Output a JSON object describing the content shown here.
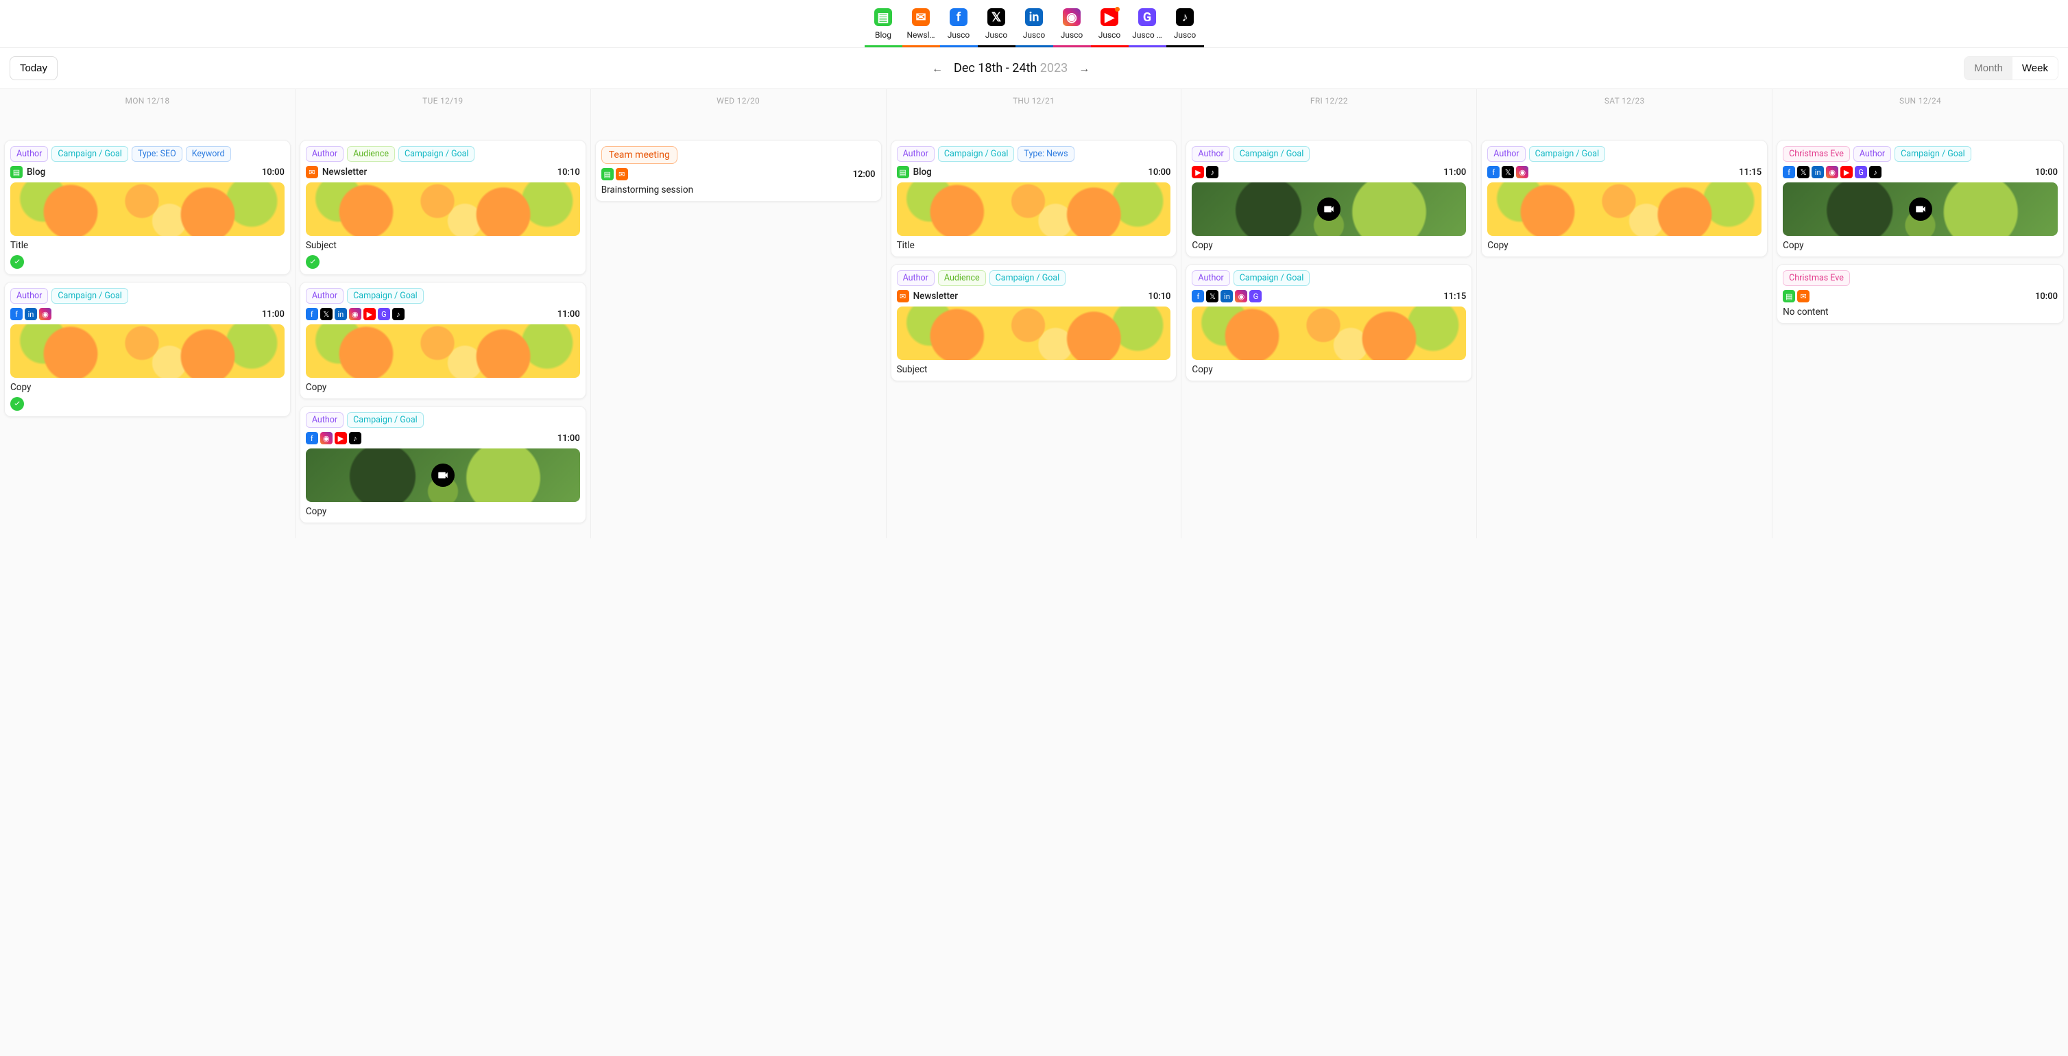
{
  "tabs": [
    {
      "label": "Blog",
      "icon": "blog",
      "color": "#2ecc40"
    },
    {
      "label": "Newsl…",
      "icon": "news",
      "color": "#ff6b00"
    },
    {
      "label": "Jusco",
      "icon": "fb",
      "color": "#1877f2"
    },
    {
      "label": "Jusco",
      "icon": "x",
      "color": "#000000"
    },
    {
      "label": "Jusco",
      "icon": "li",
      "color": "#0a66c2"
    },
    {
      "label": "Jusco",
      "icon": "ig",
      "color": "#dd2a7b"
    },
    {
      "label": "Jusco",
      "icon": "yt",
      "color": "#ff0000",
      "notif": true
    },
    {
      "label": "Jusco …",
      "icon": "gg",
      "color": "#6b46ff"
    },
    {
      "label": "Jusco",
      "icon": "tk",
      "color": "#000000"
    }
  ],
  "controls": {
    "today": "Today",
    "range": "Dec 18th - 24th",
    "year": "2023",
    "month": "Month",
    "week": "Week"
  },
  "days": [
    {
      "head": "MON 12/18"
    },
    {
      "head": "TUE 12/19"
    },
    {
      "head": "WED 12/20"
    },
    {
      "head": "THU 12/21"
    },
    {
      "head": "FRI 12/22"
    },
    {
      "head": "SAT 12/23"
    },
    {
      "head": "SUN 12/24"
    }
  ],
  "labels": {
    "author": "Author",
    "campaign": "Campaign / Goal",
    "typeSEO": "Type: SEO",
    "typeNews": "Type: News",
    "keyword": "Keyword",
    "audience": "Audience",
    "christmas": "Christmas Eve",
    "blog": "Blog",
    "newsletter": "Newsletter",
    "title": "Title",
    "subject": "Subject",
    "copy": "Copy",
    "teamMeeting": "Team meeting",
    "brainstorm": "Brainstorming session",
    "noContent": "No content"
  },
  "times": {
    "t1000": "10:00",
    "t1010": "10:10",
    "t1100": "11:00",
    "t1115": "11:15",
    "t1200": "12:00"
  }
}
